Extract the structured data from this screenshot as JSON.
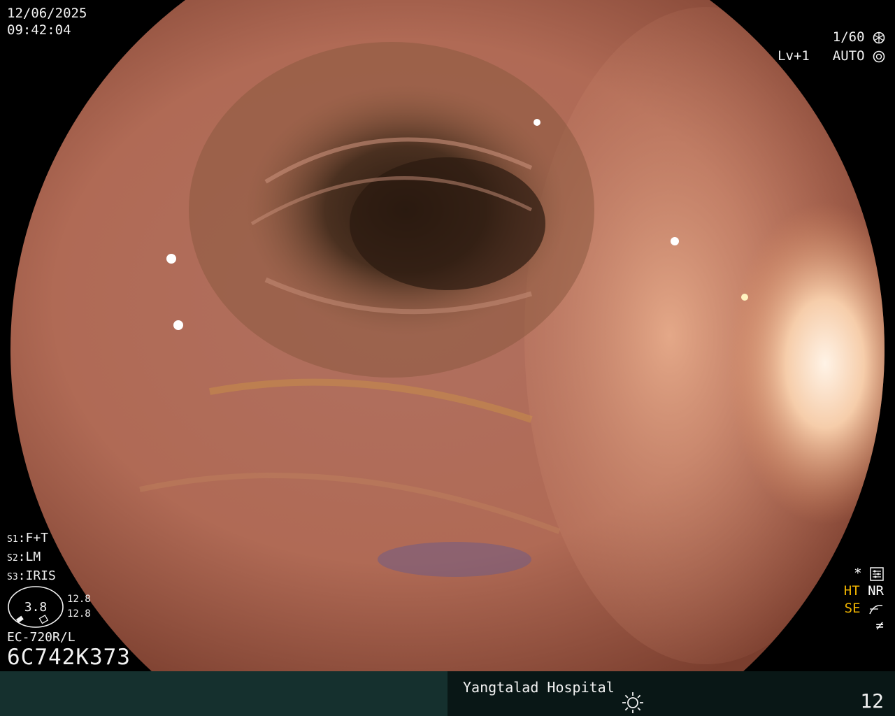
{
  "datetime": {
    "date": "12/06/2025",
    "time": "09:42:04"
  },
  "top_right": {
    "shutter": "1/60",
    "shutter_icon": "aperture-icon",
    "level": "Lv+1",
    "mode": "AUTO",
    "mode_icon": "iris-icon"
  },
  "settings": [
    {
      "key": "S1",
      "value": "F+T"
    },
    {
      "key": "S2",
      "value": "LM"
    },
    {
      "key": "S3",
      "value": "IRIS"
    }
  ],
  "gauge": {
    "value": "3.8",
    "val_1": "12.8",
    "val_2": "12.8"
  },
  "scope": {
    "model": "EC-720R/L",
    "serial": "6C742K373"
  },
  "status": {
    "asterisk": "*",
    "menu_icon": "settings-list-icon",
    "ht": "HT",
    "nr": "NR",
    "se": "SE",
    "se_icon": "curve-icon",
    "neq_symbol": "≠"
  },
  "bottom": {
    "hospital": "Yangtalad Hospital",
    "light_icon": "sun-icon",
    "frame_number": "12"
  },
  "colors": {
    "overlay_text": "#f2f2f2",
    "accent_yellow": "#f0b400",
    "bar_left": "#15302e",
    "bar_right": "#091716"
  }
}
